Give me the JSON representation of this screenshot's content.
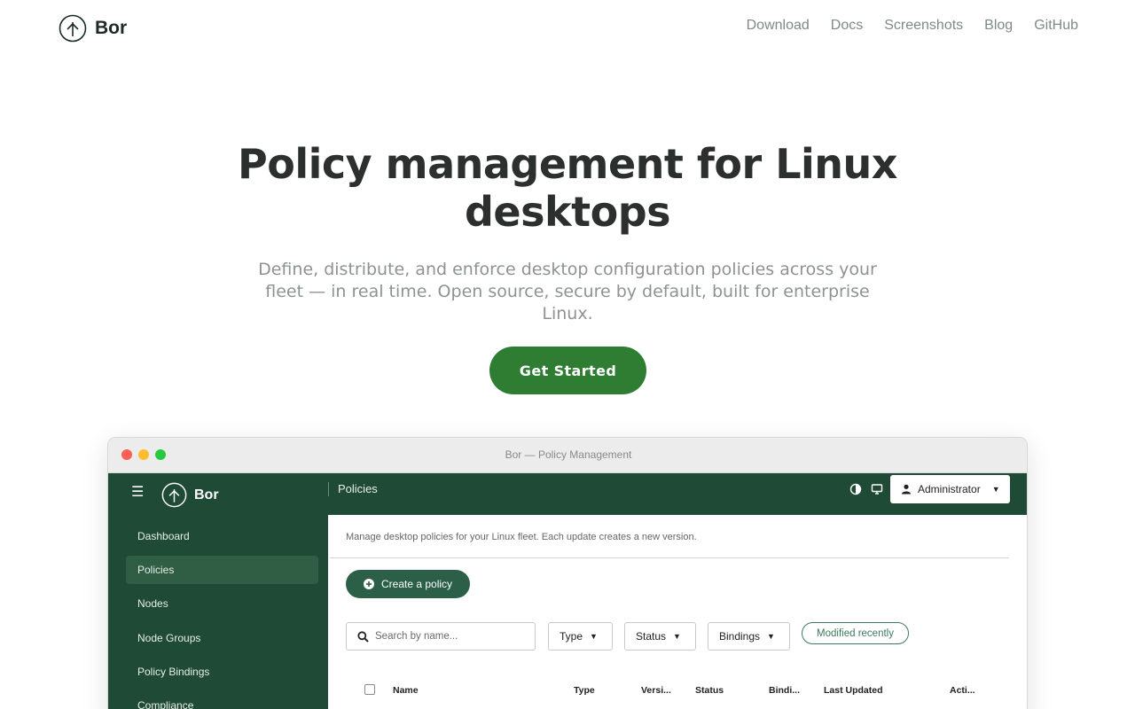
{
  "site": {
    "brand": "Bor",
    "nav": [
      "Download",
      "Docs",
      "Screenshots",
      "Blog",
      "GitHub"
    ]
  },
  "hero": {
    "title": "Policy management for Linux desktops",
    "subtitle": "Define, distribute, and enforce desktop configuration policies across your fleet — in real time. Open source, secure by default, built for enterprise Linux.",
    "cta": "Get Started"
  },
  "window": {
    "title": "Bor — Policy Management"
  },
  "app": {
    "brand": "Bor",
    "breadcrumb": "Policies",
    "user_menu": "Administrator",
    "sidebar": [
      "Dashboard",
      "Policies",
      "Nodes",
      "Node Groups",
      "Policy Bindings",
      "Compliance"
    ],
    "sidebar_active": "Policies",
    "description": "Manage desktop policies for your Linux fleet. Each update creates a new version.",
    "create_button": "Create a policy",
    "search_placeholder": "Search by name...",
    "filters": [
      "Type",
      "Status",
      "Bindings"
    ],
    "chip": "Modified recently",
    "columns": [
      "Name",
      "Type",
      "Versi...",
      "Status",
      "Bindi...",
      "Last Updated",
      "Acti..."
    ]
  },
  "colors": {
    "brand_green": "#2e7d32",
    "app_header": "#1f4a35",
    "sidebar_active": "#2f5e45",
    "chip_accent": "#3d7a5c"
  },
  "icons": {
    "logo": "tree-circle-logo",
    "menu": "hamburger-icon",
    "theme": "contrast-icon",
    "display": "monitor-icon",
    "user": "user-icon",
    "add": "plus-circle-icon",
    "search": "search-icon"
  }
}
